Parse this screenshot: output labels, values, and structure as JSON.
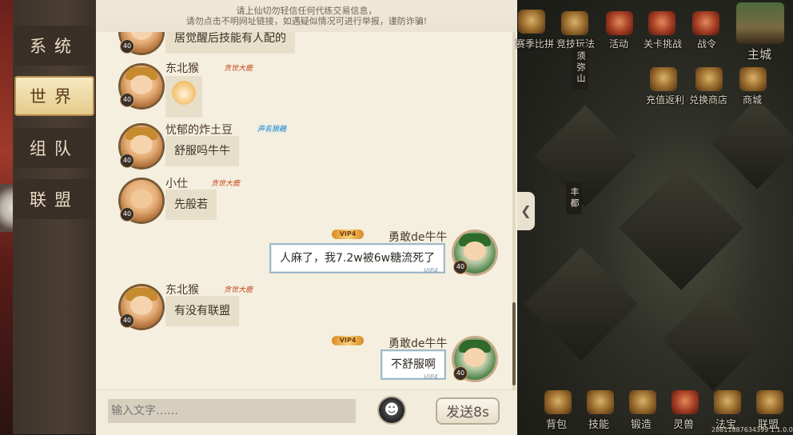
{
  "notice": {
    "line1": "请上仙切勿轻信任何代练交易信息，",
    "line2": "请勿点击不明网址链接，如遇疑似情况可进行举报，谨防诈骗!"
  },
  "tabs": [
    {
      "label": "系统",
      "active": false
    },
    {
      "label": "世界",
      "active": true
    },
    {
      "label": "组队",
      "active": false
    },
    {
      "label": "联盟",
      "active": false
    }
  ],
  "messages": [
    {
      "partial_text": "居觉醒后技能有人配的",
      "level": "40"
    },
    {
      "name": "东北猴",
      "badge": "贪世大鹿",
      "level": "40",
      "text": "",
      "sticker": "doge"
    },
    {
      "name": "忧郁的炸土豆",
      "badge": "声名狼藉",
      "level": "40",
      "text": "舒服吗牛牛"
    },
    {
      "name": "小仕",
      "badge": "贪世大鹿",
      "level": "40",
      "text": "先般若"
    },
    {
      "name": "勇敢de牛牛",
      "vip": "VIP4",
      "vip_tag": "VIP4",
      "level": "40",
      "text": "人麻了，我7.2w被6w糖流死了",
      "mine": true
    },
    {
      "name": "东北猴",
      "badge": "贪世大鹿",
      "level": "40",
      "text": "有没有联盟"
    },
    {
      "name": "勇敢de牛牛",
      "vip": "VIP4",
      "vip_tag": "VIP4",
      "level": "40",
      "text": "不舒服啊",
      "mine": true
    }
  ],
  "input": {
    "placeholder": "输入文字……",
    "value": ""
  },
  "send_button": "发送8s",
  "map": {
    "top_icons": [
      "赛季比拼",
      "竞技玩法",
      "活动",
      "关卡挑战",
      "战令"
    ],
    "main_city": "主城",
    "shop_icons": [
      "充值返利",
      "兑换商店",
      "商城"
    ],
    "locations": [
      "须弥山",
      "丰都"
    ],
    "bottom_icons": [
      "背包",
      "技能",
      "锻造",
      "灵兽",
      "法宝",
      "联盟"
    ],
    "footer": "28811887634399 1.1.0.0"
  }
}
